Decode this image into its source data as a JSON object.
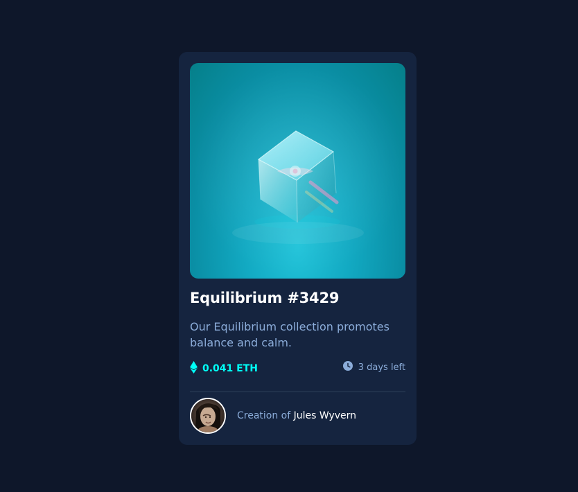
{
  "card": {
    "image_alt": "Equilibrium crystal cube",
    "title": "Equilibrium #3429",
    "description": "Our Equilibrium collection promotes balance and calm.",
    "price": "0.041 ETH",
    "time_left": "3 days left",
    "creator_prefix": "Creation of ",
    "creator_name": "Jules Wyvern"
  },
  "icons": {
    "price": "ethereum-icon",
    "time": "clock-icon",
    "avatar": "avatar"
  },
  "colors": {
    "page_background": "#0e172a",
    "card_background": "#15243f",
    "accent_cyan": "#00fff7",
    "soft_blue": "#8bacd9",
    "white": "#ffffff",
    "divider": "#2e405a"
  }
}
